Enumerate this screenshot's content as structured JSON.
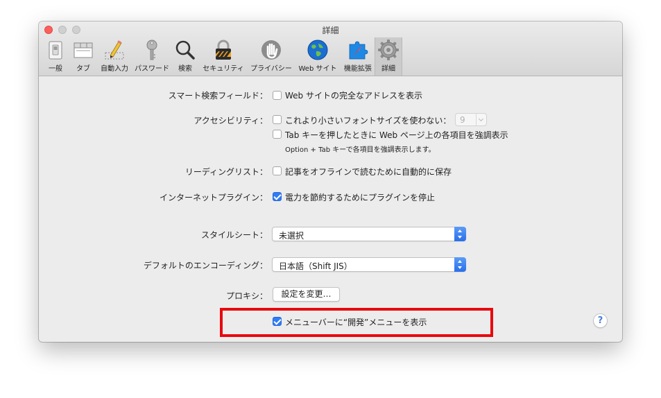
{
  "window": {
    "title": "詳細",
    "traffic_lights": [
      "close",
      "minimize",
      "zoom"
    ]
  },
  "toolbar": {
    "items": [
      {
        "label": "一般",
        "icon": "general-switch-icon",
        "selected": false
      },
      {
        "label": "タブ",
        "icon": "tabs-icon",
        "selected": false
      },
      {
        "label": "自動入力",
        "icon": "autofill-pencil-icon",
        "selected": false
      },
      {
        "label": "パスワード",
        "icon": "key-icon",
        "selected": false
      },
      {
        "label": "検索",
        "icon": "magnifier-icon",
        "selected": false
      },
      {
        "label": "セキュリティ",
        "icon": "padlock-icon",
        "selected": false
      },
      {
        "label": "プライバシー",
        "icon": "hand-icon",
        "selected": false
      },
      {
        "label": "Web サイト",
        "icon": "globe-icon",
        "selected": false
      },
      {
        "label": "機能拡張",
        "icon": "puzzle-compass-icon",
        "selected": false
      },
      {
        "label": "詳細",
        "icon": "gear-icon",
        "selected": true
      }
    ]
  },
  "settings": {
    "smart_search": {
      "label": "スマート検索フィールド：",
      "option": "Web サイトの完全なアドレスを表示",
      "checked": false
    },
    "accessibility": {
      "label": "アクセシビリティ：",
      "font_option": "これより小さいフォントサイズを使わない：",
      "font_checked": false,
      "font_size_value": "9",
      "tab_option": "Tab キーを押したときに Web ページ上の各項目を強調表示",
      "tab_checked": false,
      "tab_note": "Option + Tab キーで各項目を強調表示します。"
    },
    "reading_list": {
      "label": "リーディングリスト：",
      "option": "記事をオフラインで読むために自動的に保存",
      "checked": false
    },
    "internet_plugins": {
      "label": "インターネットプラグイン：",
      "option": "電力を節約するためにプラグインを停止",
      "checked": true
    },
    "style_sheet": {
      "label": "スタイルシート：",
      "value": "未選択"
    },
    "default_encoding": {
      "label": "デフォルトのエンコーディング：",
      "value": "日本語（Shift JIS）"
    },
    "proxies": {
      "label": "プロキシ：",
      "button": "設定を変更…"
    },
    "develop_menu": {
      "option": "メニューバーに“開発”メニューを表示",
      "checked": true
    },
    "help": "?"
  },
  "colors": {
    "accent": "#2f7cf6",
    "highlight_border": "#e8090d",
    "window_bg": "#ececec",
    "close_button": "#fc605c"
  }
}
